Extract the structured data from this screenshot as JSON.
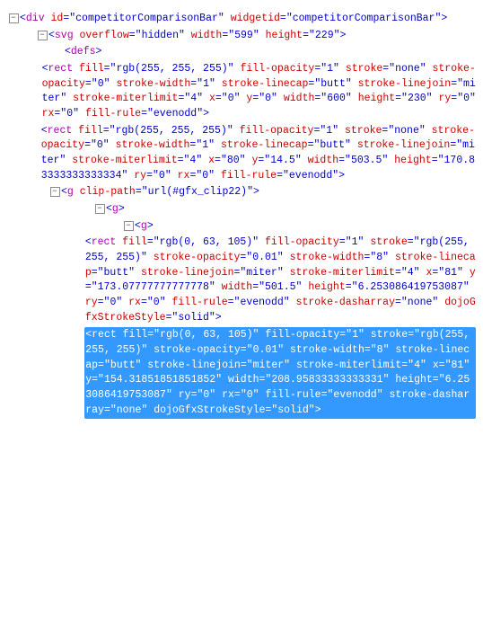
{
  "tree": {
    "line1": {
      "tag": "div",
      "attrs": [
        [
          "id",
          "competitorComparisonBar"
        ],
        [
          "widgetid",
          "competitorComparisonBar"
        ]
      ]
    },
    "line2": {
      "tag": "svg",
      "attrs": [
        [
          "overflow",
          "hidden"
        ],
        [
          "width",
          "599"
        ],
        [
          "height",
          "229"
        ]
      ]
    },
    "line3": {
      "tag": "defs"
    },
    "line4": {
      "tag": "rect",
      "attrs": [
        [
          "fill",
          "rgb(255, 255, 255)"
        ],
        [
          "fill-opacity",
          "1"
        ],
        [
          "stroke",
          "none"
        ],
        [
          "stroke-opacity",
          "0"
        ],
        [
          "stroke-width",
          "1"
        ],
        [
          "stroke-linecap",
          "butt"
        ],
        [
          "stroke-linejoin",
          "miter"
        ],
        [
          "stroke-miterlimit",
          "4"
        ],
        [
          "x",
          "0"
        ],
        [
          "y",
          "0"
        ],
        [
          "width",
          "600"
        ],
        [
          "height",
          "230"
        ],
        [
          "ry",
          "0"
        ],
        [
          "rx",
          "0"
        ],
        [
          "fill-rule",
          "evenodd"
        ]
      ]
    },
    "line5": {
      "tag": "rect",
      "attrs": [
        [
          "fill",
          "rgb(255, 255, 255)"
        ],
        [
          "fill-opacity",
          "1"
        ],
        [
          "stroke",
          "none"
        ],
        [
          "stroke-opacity",
          "0"
        ],
        [
          "stroke-width",
          "1"
        ],
        [
          "stroke-linecap",
          "butt"
        ],
        [
          "stroke-linejoin",
          "miter"
        ],
        [
          "stroke-miterlimit",
          "4"
        ],
        [
          "x",
          "80"
        ],
        [
          "y",
          "14.5"
        ],
        [
          "width",
          "503.5"
        ],
        [
          "height",
          "170.83333333333334"
        ],
        [
          "ry",
          "0"
        ],
        [
          "rx",
          "0"
        ],
        [
          "fill-rule",
          "evenodd"
        ]
      ]
    },
    "line6": {
      "tag": "g",
      "attrs": [
        [
          "clip-path",
          "url(#gfx_clip22)"
        ]
      ]
    },
    "line7": {
      "tag": "g"
    },
    "line8": {
      "tag": "g"
    },
    "line9": {
      "tag": "rect",
      "attrs": [
        [
          "fill",
          "rgb(0, 63, 105)"
        ],
        [
          "fill-opacity",
          "1"
        ],
        [
          "stroke",
          "rgb(255, 255, 255)"
        ],
        [
          "stroke-opacity",
          "0.01"
        ],
        [
          "stroke-width",
          "8"
        ],
        [
          "stroke-linecap",
          "butt"
        ],
        [
          "stroke-linejoin",
          "miter"
        ],
        [
          "stroke-miterlimit",
          "4"
        ],
        [
          "x",
          "81"
        ],
        [
          "y",
          "173.07777777777778"
        ],
        [
          "width",
          "501.5"
        ],
        [
          "height",
          "6.253086419753087"
        ],
        [
          "ry",
          "0"
        ],
        [
          "rx",
          "0"
        ],
        [
          "fill-rule",
          "evenodd"
        ],
        [
          "stroke-dasharray",
          "none"
        ],
        [
          "dojoGfxStrokeStyle",
          "solid"
        ]
      ]
    },
    "line10": {
      "tag": "rect",
      "attrs": [
        [
          "fill",
          "rgb(0, 63, 105)"
        ],
        [
          "fill-opacity",
          "1"
        ],
        [
          "stroke",
          "rgb(255, 255, 255)"
        ],
        [
          "stroke-opacity",
          "0.01"
        ],
        [
          "stroke-width",
          "8"
        ],
        [
          "stroke-linecap",
          "butt"
        ],
        [
          "stroke-linejoin",
          "miter"
        ],
        [
          "stroke-miterlimit",
          "4"
        ],
        [
          "x",
          "81"
        ],
        [
          "y",
          "154.31851851851852"
        ],
        [
          "width",
          "208.95833333333331"
        ],
        [
          "height",
          "6.253086419753087"
        ],
        [
          "ry",
          "0"
        ],
        [
          "rx",
          "0"
        ],
        [
          "fill-rule",
          "evenodd"
        ],
        [
          "stroke-dasharray",
          "none"
        ],
        [
          "dojoGfxStrokeStyle",
          "solid"
        ]
      ]
    }
  },
  "glyphs": {
    "collapse": "−"
  }
}
